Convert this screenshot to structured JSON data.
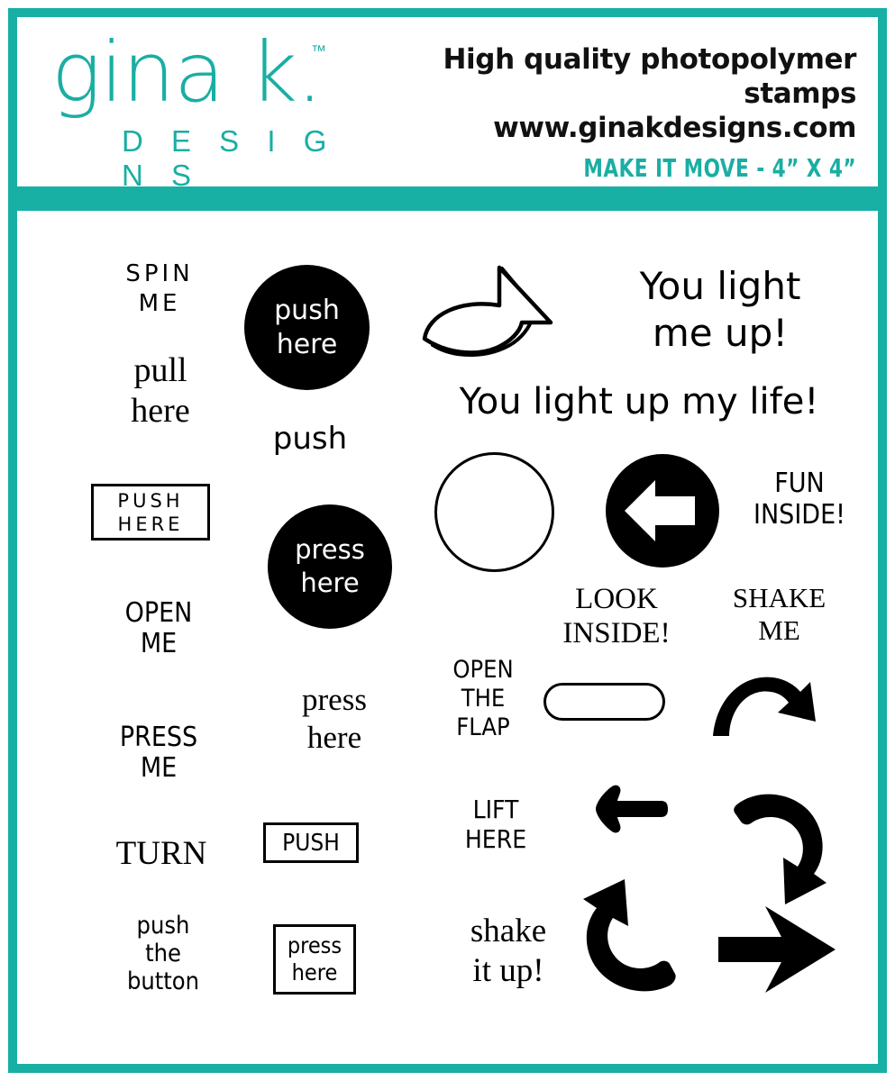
{
  "brand": {
    "logo_name": "gina k.",
    "logo_tm": "™",
    "logo_sub": "D E S I G N S",
    "tagline_1": "High quality photopolymer stamps",
    "tagline_2": "www.ginakdesigns.com",
    "product_line": "MAKE IT MOVE - 4” X 4”",
    "teal": "#18AFA4",
    "black": "#000000"
  },
  "stamps": {
    "spin_me_line1": "SPIN",
    "spin_me_line2": "ME",
    "pull_here_line1": "pull",
    "pull_here_line2": "here",
    "push_here_box_line1": "PUSH",
    "push_here_box_line2": "HERE",
    "open_me_line1": "OPEN",
    "open_me_line2": "ME",
    "press_me_line1": "PRESS",
    "press_me_line2": "ME",
    "turn": "TURN",
    "push_the_button_line1": "push",
    "push_the_button_line2": "the",
    "push_the_button_line3": "button",
    "push_here_circle_line1": "push",
    "push_here_circle_line2": "here",
    "push_word": "push",
    "press_here_circle_line1": "press",
    "press_here_circle_line2": "here",
    "press_here_serif_line1": "press",
    "press_here_serif_line2": "here",
    "push_box": "PUSH",
    "press_here_box_line1": "press",
    "press_here_box_line2": "here",
    "you_light_me_up_line1": "You light",
    "you_light_me_up_line2": "me up!",
    "you_light_up_my_life": "You light up my life!",
    "fun_inside_line1": "FUN",
    "fun_inside_line2": "INSIDE!",
    "look_inside_line1": "LOOK",
    "look_inside_line2": "INSIDE!",
    "shake_me_line1": "SHAKE",
    "shake_me_line2": "ME",
    "open_the_flap_line1": "OPEN",
    "open_the_flap_line2": "THE",
    "open_the_flap_line3": "FLAP",
    "lift_here_line1": "LIFT",
    "lift_here_line2": "HERE",
    "shake_it_up_line1": "shake",
    "shake_it_up_line2": "it up!"
  },
  "shapes": {
    "curved_arrow_outline": "curved-arrow-up-outline",
    "circle_outline": "circle-outline",
    "circle_left_arrow": "circle-left-arrow-filled",
    "pill_outline": "pill-outline",
    "curved_arrow_right": "curved-arrow-right-filled",
    "short_left_arrow": "short-left-arrow-filled",
    "curved_arrow_down_right": "curved-arrow-down-right-filled",
    "curved_arrow_up_left": "curved-arrow-up-left-filled",
    "bold_right_arrow": "bold-right-arrow-filled"
  }
}
